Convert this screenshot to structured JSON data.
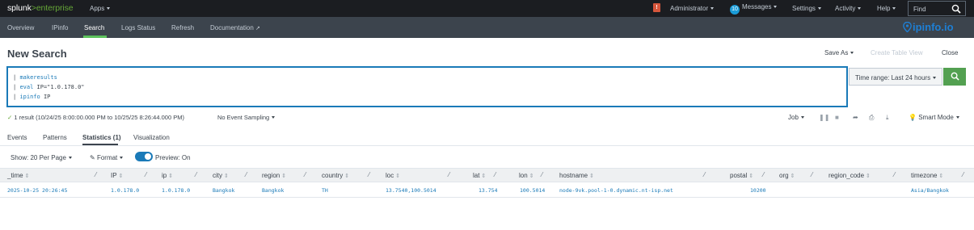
{
  "topbar": {
    "logo_main": "splunk",
    "logo_sep": ">",
    "logo_sub": "enterprise",
    "apps": "Apps",
    "alert_badge": "!",
    "administrator": "Administrator",
    "messages_count": "10",
    "messages": "Messages",
    "settings": "Settings",
    "activity": "Activity",
    "help": "Help",
    "find_placeholder": "Find"
  },
  "appbar": {
    "items": [
      "Overview",
      "IPinfo",
      "Search",
      "Logs Status",
      "Refresh",
      "Documentation"
    ],
    "active": "Search",
    "brand": "ipinfo.io"
  },
  "header": {
    "title": "New Search",
    "save_as": "Save As",
    "create_table_view": "Create Table View",
    "close": "Close"
  },
  "search": {
    "lines": [
      {
        "pipe": "| ",
        "cmd": "makeresults",
        "rest": ""
      },
      {
        "pipe": "| ",
        "cmd": "eval",
        "rest": " IP=\"1.0.178.0\""
      },
      {
        "pipe": "| ",
        "cmd": "ipinfo",
        "rest": " IP"
      }
    ],
    "time_range": "Time range: Last 24 hours"
  },
  "status": {
    "check": "✓",
    "text": "1 result (10/24/25 8:00:00.000 PM to 10/25/25 8:26:44.000 PM)",
    "sampling": "No Event Sampling",
    "job": "Job",
    "smart_mode": "Smart Mode"
  },
  "result_tabs": [
    "Events",
    "Patterns",
    "Statistics (1)",
    "Visualization"
  ],
  "controls": {
    "per_page": "Show: 20 Per Page",
    "format": "Format",
    "preview": "Preview: On"
  },
  "table": {
    "columns": [
      "_time",
      "IP",
      "ip",
      "city",
      "region",
      "country",
      "loc",
      "lat",
      "lon",
      "hostname",
      "postal",
      "org",
      "region_code",
      "timezone"
    ],
    "rows": [
      [
        "2025-10-25 20:26:45",
        "1.0.178.0",
        "1.0.178.0",
        "Bangkok",
        "Bangkok",
        "TH",
        "13.7540,100.5014",
        "13.754",
        "100.5014",
        "node-9vk.pool-1-0.dynamic.nt-isp.net",
        "10200",
        "",
        "",
        "Asia/Bangkok"
      ]
    ]
  },
  "colors": {
    "topbar_bg": "#1b1d21",
    "appbar_bg": "#3c444d",
    "accent_green": "#53a051",
    "link_blue": "#1a7ab8"
  }
}
